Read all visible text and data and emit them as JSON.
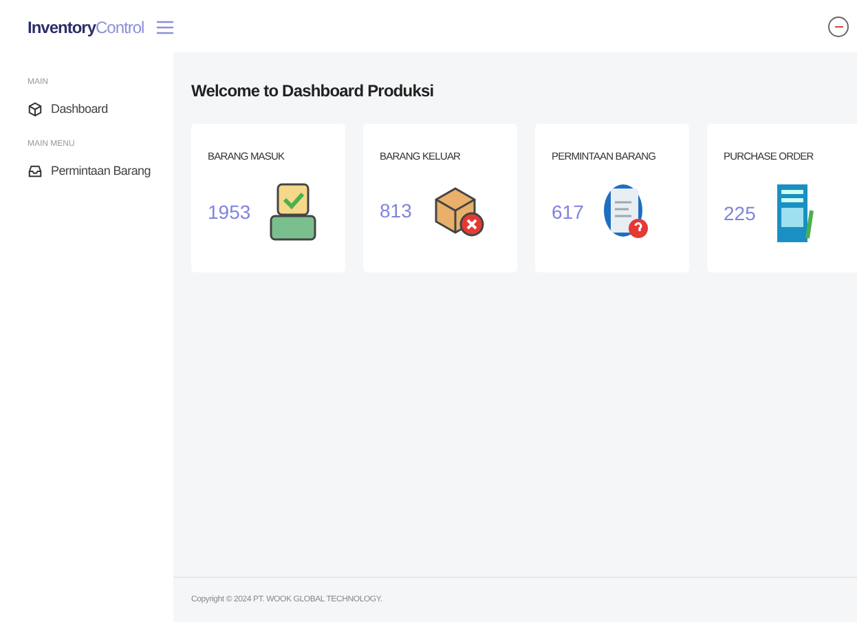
{
  "brand": {
    "bold": "Inventory",
    "light": "Control"
  },
  "sidebar": {
    "sections": [
      {
        "heading": "MAIN",
        "items": [
          {
            "label": "Dashboard",
            "kind": "cube"
          }
        ]
      },
      {
        "heading": "MAIN MENU",
        "items": [
          {
            "label": "Permintaan Barang",
            "kind": "inbox"
          }
        ]
      }
    ]
  },
  "page_title": "Welcome to Dashboard Produksi",
  "cards": [
    {
      "title": "BARANG MASUK",
      "value": "1953",
      "kind": "instock"
    },
    {
      "title": "BARANG KELUAR",
      "value": "813",
      "kind": "box-cancel"
    },
    {
      "title": "PERMINTAAN BARANG",
      "value": "617",
      "kind": "document-question"
    },
    {
      "title": "PURCHASE ORDER",
      "value": "225",
      "kind": "form"
    }
  ],
  "footer": "Copyright © 2024 PT. WOOK GLOBAL TECHNOLOGY."
}
